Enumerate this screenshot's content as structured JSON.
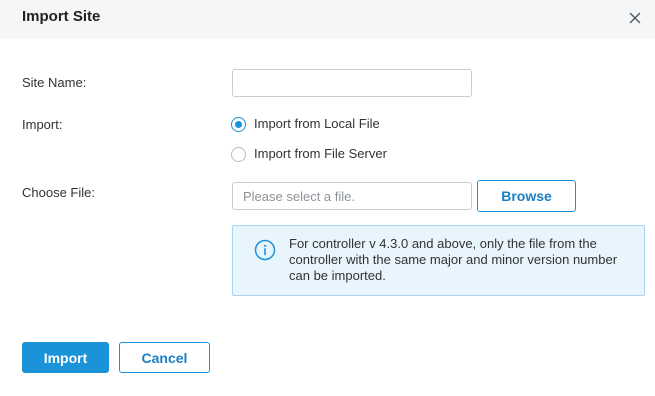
{
  "dialog": {
    "title": "Import Site",
    "close_icon": "close-icon"
  },
  "form": {
    "site_name": {
      "label": "Site Name:",
      "value": "",
      "placeholder": ""
    },
    "import": {
      "label": "Import:",
      "options": [
        {
          "label": "Import from Local File",
          "checked": true
        },
        {
          "label": "Import from File Server",
          "checked": false
        }
      ]
    },
    "choose_file": {
      "label": "Choose File:",
      "placeholder": "Please select a file.",
      "browse_label": "Browse"
    },
    "info": {
      "icon": "info-icon",
      "text": "For controller v 4.3.0 and above, only the file from the controller with the same major and minor version number can be imported."
    }
  },
  "footer": {
    "import_label": "Import",
    "cancel_label": "Cancel"
  },
  "colors": {
    "accent": "#1b93d8",
    "info_background": "#e9f5fc",
    "header_background": "#f5f6f8"
  }
}
